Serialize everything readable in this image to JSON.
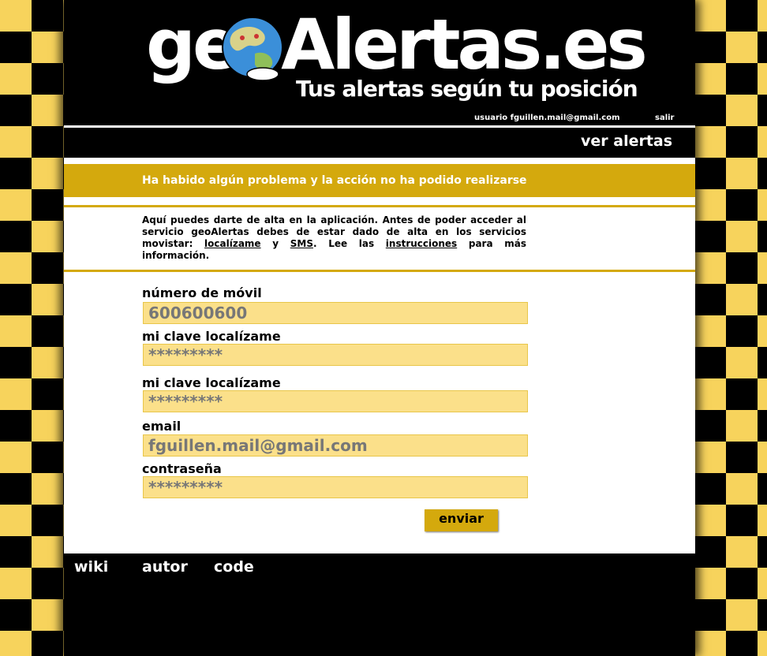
{
  "header": {
    "logo_main": "geoAlertas.es",
    "tagline": "Tus alertas según tu posición"
  },
  "userbar": {
    "user_label": "usuario fguillen.mail@gmail.com",
    "logout_label": "salir"
  },
  "nav": {
    "view_alerts_label": "ver alertas"
  },
  "error": {
    "message": "Ha habido algún problema y la acción no ha podido realizarse"
  },
  "intro": {
    "text_1": "Aquí puedes darte de alta en la aplicación. Antes de poder acceder al servicio geoAlertas debes de estar dado de alta en los servicios movistar: ",
    "link_localizame": "localízame",
    "text_2": " y ",
    "link_sms": "SMS",
    "text_3": ". Lee las ",
    "link_instructions": "instrucciones",
    "text_4": " para más información."
  },
  "form": {
    "mobile_label": "número de móvil",
    "mobile_value": "600600600",
    "key_label": "mi clave localízame",
    "key_value": "*********",
    "key_confirm_label": "mi clave localízame",
    "key_confirm_value": "*********",
    "email_label": "email",
    "email_value": "fguillen.mail@gmail.com",
    "password_label": "contraseña",
    "password_value": "*********",
    "submit_label": "enviar"
  },
  "footer": {
    "wiki_label": "wiki",
    "author_label": "autor",
    "code_label": "code"
  },
  "colors": {
    "accent": "#d4a90d",
    "input_bg": "#fbe08a",
    "checker_light": "#f7d35c",
    "checker_dark": "#000000"
  }
}
